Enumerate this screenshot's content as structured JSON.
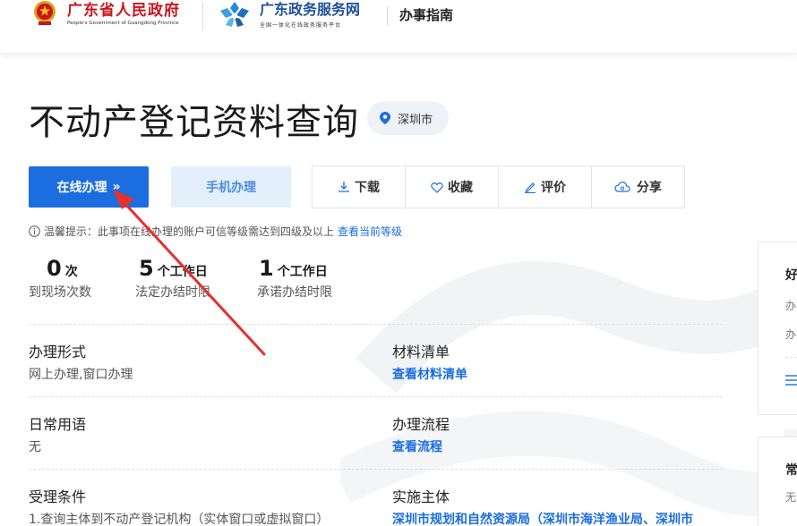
{
  "header": {
    "gov_title": "广东省人民政府",
    "gov_subtitle": "People's Government of Guangdong Province",
    "portal_title": "广东政务服务网",
    "portal_subtitle": "全国一体化在线政务服务平台",
    "section": "办事指南"
  },
  "page": {
    "title": "不动产登记资料查询",
    "region": "深圳市"
  },
  "buttons": {
    "online": "在线办理",
    "online_arrow": "»",
    "mobile": "手机办理",
    "download": "下载",
    "favorite": "收藏",
    "rate": "评价",
    "share": "分享"
  },
  "tip": {
    "text": "温馨提示：此事项在线办理的账户可信等级需达到四级及以上",
    "link": "查看当前等级"
  },
  "stats": [
    {
      "num": "0",
      "unit": "次",
      "label": "到现场次数"
    },
    {
      "num": "5",
      "unit": "个工作日",
      "label": "法定办结时限"
    },
    {
      "num": "1",
      "unit": "个工作日",
      "label": "承诺办结时限"
    }
  ],
  "info": {
    "form_key": "办理形式",
    "form_value": "网上办理,窗口办理",
    "materials_key": "材料清单",
    "materials_link": "查看材料清单",
    "phrases_key": "日常用语",
    "phrases_value": "无",
    "process_key": "办理流程",
    "process_link": "查看流程",
    "conditions_key": "受理条件",
    "conditions_value": "1.查询主体到不动产登记机构（实体窗口或虚拟窗口）",
    "agency_key": "实施主体",
    "agency_link": "深圳市规划和自然资源局（深圳市海洋渔业局、深圳市"
  },
  "side": {
    "card1_title": "好",
    "card1_line1": "办",
    "card1_line2": "办",
    "card1_icon": "list-icon",
    "card2_title": "常",
    "card2_line1": "无"
  },
  "colors": {
    "primary": "#1b6de0",
    "primary_light": "#e4effc",
    "gov_red": "#c9151e",
    "portal_blue": "#1d4f9d",
    "annotation_arrow": "#e5312c"
  }
}
